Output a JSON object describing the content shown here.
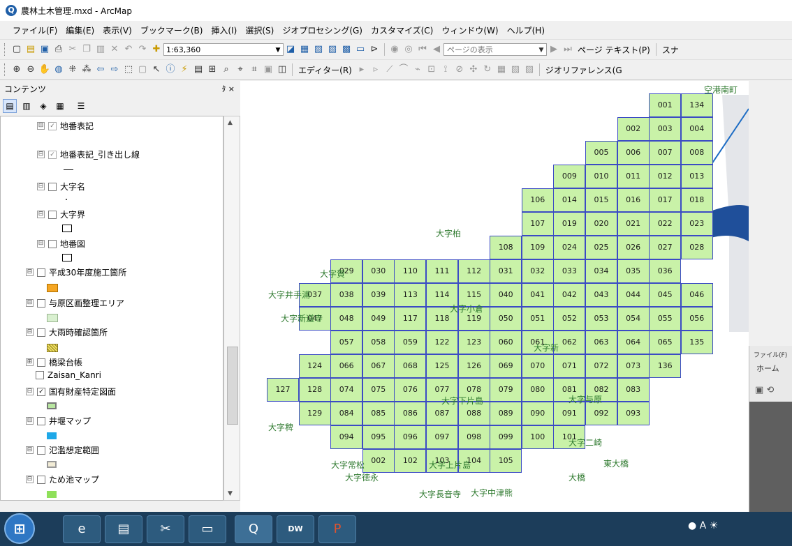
{
  "window": {
    "title": "農林土木管理.mxd - ArcMap",
    "app_icon": "arcmap-globe-icon"
  },
  "menu": [
    "ファイル(F)",
    "編集(E)",
    "表示(V)",
    "ブックマーク(B)",
    "挿入(I)",
    "選択(S)",
    "ジオプロセシング(G)",
    "カスタマイズ(C)",
    "ウィンドウ(W)",
    "ヘルプ(H)"
  ],
  "toolbar": {
    "scale": "1:63,360",
    "page_placeholder": "ページの表示",
    "page_text_label": "ページ テキスト(P)",
    "editor_label": "エディター(R)",
    "georef_label": "ジオリファレンス(G",
    "sna_label": "スナ"
  },
  "toc": {
    "title": "コンテンツ",
    "pin": "ﾀ ×",
    "layers": [
      {
        "label": "地番表記",
        "expander": "⊟",
        "checked": true,
        "greyed": true
      },
      {
        "label": "地番表記_引き出し線",
        "expander": "⊟",
        "checked": true,
        "greyed": true
      },
      {
        "label": "大字名",
        "expander": "⊟",
        "checked": false
      },
      {
        "label": "大字界",
        "expander": "⊟",
        "checked": false
      },
      {
        "label": "地番図",
        "expander": "⊟",
        "checked": false
      },
      {
        "label": "平成30年度施工箇所",
        "expander": "⊟",
        "checked": false,
        "symbol_color": "#f5a623"
      },
      {
        "label": "与原区画整理エリア",
        "expander": "⊟",
        "checked": false,
        "symbol_color": "#d9f0d0"
      },
      {
        "label": "大雨時確認箇所",
        "expander": "⊟",
        "checked": false,
        "symbol_color": "#f0e060"
      },
      {
        "label": "橋梁台帳",
        "expander": "⊞",
        "checked": false
      },
      {
        "label": "Zaisan_Kanri",
        "expander": "",
        "checked": false
      },
      {
        "label": "国有財産特定図面",
        "expander": "⊟",
        "checked": true,
        "symbol_color": "#b8e6a0"
      },
      {
        "label": "井堰マップ",
        "expander": "⊟",
        "checked": false,
        "symbol_color": "#1ea8e8"
      },
      {
        "label": "氾濫想定範囲",
        "expander": "⊟",
        "checked": false,
        "symbol_color": "#f2ecd6"
      },
      {
        "label": "ため池マップ",
        "expander": "⊟",
        "checked": false,
        "symbol_color": "#8fe05a"
      }
    ]
  },
  "map": {
    "corner_label": "空港南町",
    "tiles": [
      [
        "001",
        "134"
      ],
      [
        "002",
        "003",
        "004"
      ],
      [
        "005",
        "006",
        "007",
        "008"
      ],
      [
        "009",
        "010",
        "011",
        "012",
        "013"
      ],
      [
        "106",
        "014",
        "015",
        "016",
        "017",
        "018"
      ],
      [
        "107",
        "019",
        "020",
        "021",
        "022",
        "023"
      ],
      [
        "108",
        "109",
        "024",
        "025",
        "026",
        "027",
        "028"
      ],
      [
        "029",
        "030",
        "110",
        "111",
        "112",
        "031",
        "032",
        "033",
        "034",
        "035",
        "036"
      ],
      [
        "037",
        "038",
        "039",
        "113",
        "114",
        "115",
        "040",
        "041",
        "042",
        "043",
        "044",
        "045",
        "046"
      ],
      [
        "047",
        "048",
        "049",
        "117",
        "118",
        "119",
        "050",
        "051",
        "052",
        "053",
        "054",
        "055",
        "056"
      ],
      [
        "057",
        "058",
        "059",
        "122",
        "123",
        "060",
        "061",
        "062",
        "063",
        "064",
        "065",
        "135"
      ],
      [
        "124",
        "066",
        "067",
        "068",
        "125",
        "126",
        "069",
        "070",
        "071",
        "072",
        "073",
        "136"
      ],
      [
        "127",
        "128",
        "074",
        "075",
        "076",
        "077",
        "078",
        "079",
        "080",
        "081",
        "082",
        "083"
      ],
      [
        "129",
        "084",
        "085",
        "086",
        "087",
        "088",
        "089",
        "090",
        "091",
        "092",
        "093"
      ],
      [
        "094",
        "095",
        "096",
        "097",
        "098",
        "099",
        "100",
        "101"
      ],
      [
        "002",
        "102",
        "103",
        "104",
        "105"
      ]
    ],
    "place_labels": [
      "大字賀",
      "大字井手浦",
      "大字新道寺",
      "大字稗",
      "大字柏",
      "大字小倉",
      "大字新",
      "大字与原",
      "大字徳永",
      "大字常松",
      "大字上片島",
      "大字長音寺",
      "大字中津熊",
      "大字下片島",
      "大字二崎",
      "東大橋",
      "大橋"
    ]
  },
  "other_window": {
    "menu": "ファイル(F)",
    "home": "ホーム"
  },
  "taskbar": {
    "apps": [
      "ie-icon",
      "explorer-icon",
      "snipping-tool-icon",
      "folder-icon",
      "arcmap-icon",
      "dreamweaver-icon",
      "powerpoint-icon"
    ],
    "dw_label": "DW",
    "tray_text": "A"
  }
}
